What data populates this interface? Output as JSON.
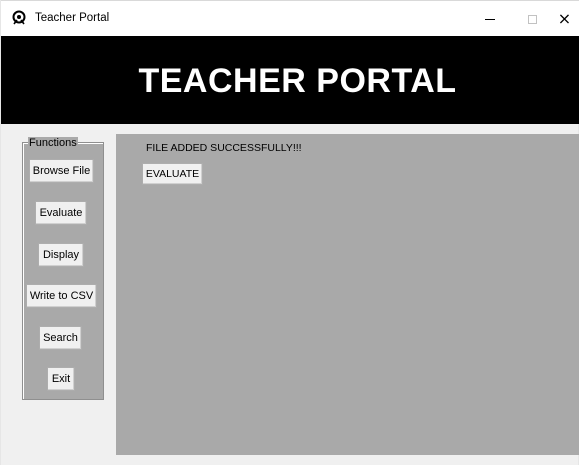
{
  "window": {
    "title": "Teacher Portal",
    "icon": "feather-logo-icon",
    "controls": {
      "minimize": "–",
      "maximize": "□",
      "close": "×"
    }
  },
  "banner": {
    "title": "TEACHER PORTAL",
    "background": "#000000",
    "color": "#ffffff"
  },
  "functions": {
    "legend": "Functions",
    "buttons": [
      {
        "label": "Browse File"
      },
      {
        "label": "Evaluate"
      },
      {
        "label": "Display"
      },
      {
        "label": "Write to CSV"
      },
      {
        "label": "Search"
      },
      {
        "label": "Exit"
      }
    ]
  },
  "main": {
    "status": "FILE ADDED SUCCESSFULLY!!!",
    "evaluate_button": "EVALUATE",
    "panel_color": "#a9a9a9"
  }
}
